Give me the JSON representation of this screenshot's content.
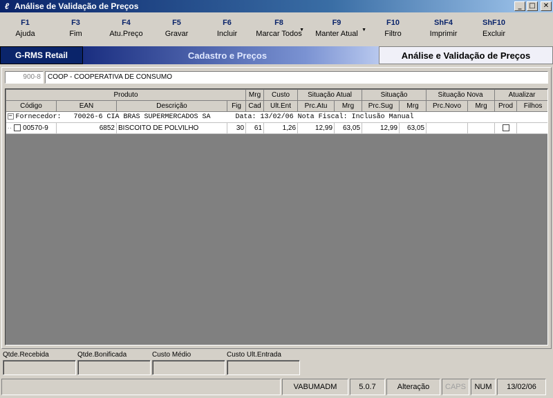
{
  "window": {
    "title": "Análise de Validação de Preços",
    "controls": [
      "_",
      "□",
      "✕"
    ]
  },
  "toolbar": [
    {
      "key": "F1",
      "label": "Ajuda",
      "icon": ""
    },
    {
      "key": "F3",
      "label": "Fim",
      "icon": ""
    },
    {
      "key": "F4",
      "label": "Atu.Preço",
      "icon": ""
    },
    {
      "key": "F5",
      "label": "Gravar",
      "icon": ""
    },
    {
      "key": "F6",
      "label": "Incluir",
      "icon": ""
    },
    {
      "key": "F8",
      "label": "Marcar Todos",
      "icon": "dropdown-arrow"
    },
    {
      "key": "F9",
      "label": "Manter Atual",
      "icon": "dropdown-arrow"
    },
    {
      "key": "F10",
      "label": "Filtro",
      "icon": ""
    },
    {
      "key": "ShF4",
      "label": "Imprimir",
      "icon": ""
    },
    {
      "key": "ShF10",
      "label": "Excluir",
      "icon": ""
    }
  ],
  "modules": {
    "brand": "G-RMS Retail",
    "section": "Cadastro e Preços",
    "screen": "Análise e Validação de Preços"
  },
  "company": {
    "code": "900-8",
    "name": "COOP - COOPERATIVA DE CONSUMO"
  },
  "grid": {
    "group_headers": [
      "Produto",
      "Mrg",
      "Custo",
      "Situação Atual",
      "Situação",
      "Situação Nova",
      "Atualizar"
    ],
    "columns": [
      "Código",
      "EAN",
      "Descrição",
      "Fig",
      "Cad",
      "Ult.Ent",
      "Prc.Atu",
      "Mrg",
      "Prc.Sug",
      "Mrg",
      "Prc.Novo",
      "Mrg",
      "Prod",
      "Filhos"
    ],
    "group_row": "Fornecedor:   70026-6 CIA BRAS SUPERMERCADOS SA      Data: 13/02/06 Nota Fiscal: Inclusão Manual",
    "rows": [
      {
        "codigo": "00570-9",
        "ean": "6852",
        "descricao": "BISCOITO DE POLVILHO",
        "fig": "30",
        "cad": "61",
        "ult_ent": "1,26",
        "prc_atu": "12,99",
        "mrg_atu": "63,05",
        "prc_sug": "12,99",
        "mrg_sug": "63,05",
        "prc_novo": "",
        "mrg_novo": "",
        "prod": false,
        "filhos": ""
      }
    ]
  },
  "fields": [
    {
      "label": "Qtde.Recebida",
      "value": ""
    },
    {
      "label": "Qtde.Bonificada",
      "value": ""
    },
    {
      "label": "Custo Médio",
      "value": ""
    },
    {
      "label": "Custo Ult.Entrada",
      "value": ""
    }
  ],
  "status": {
    "blank": "",
    "user": "VABUMADM",
    "version": "5.0.7",
    "mode": "Alteração",
    "caps": "CAPS",
    "num": "NUM",
    "date": "13/02/06"
  }
}
